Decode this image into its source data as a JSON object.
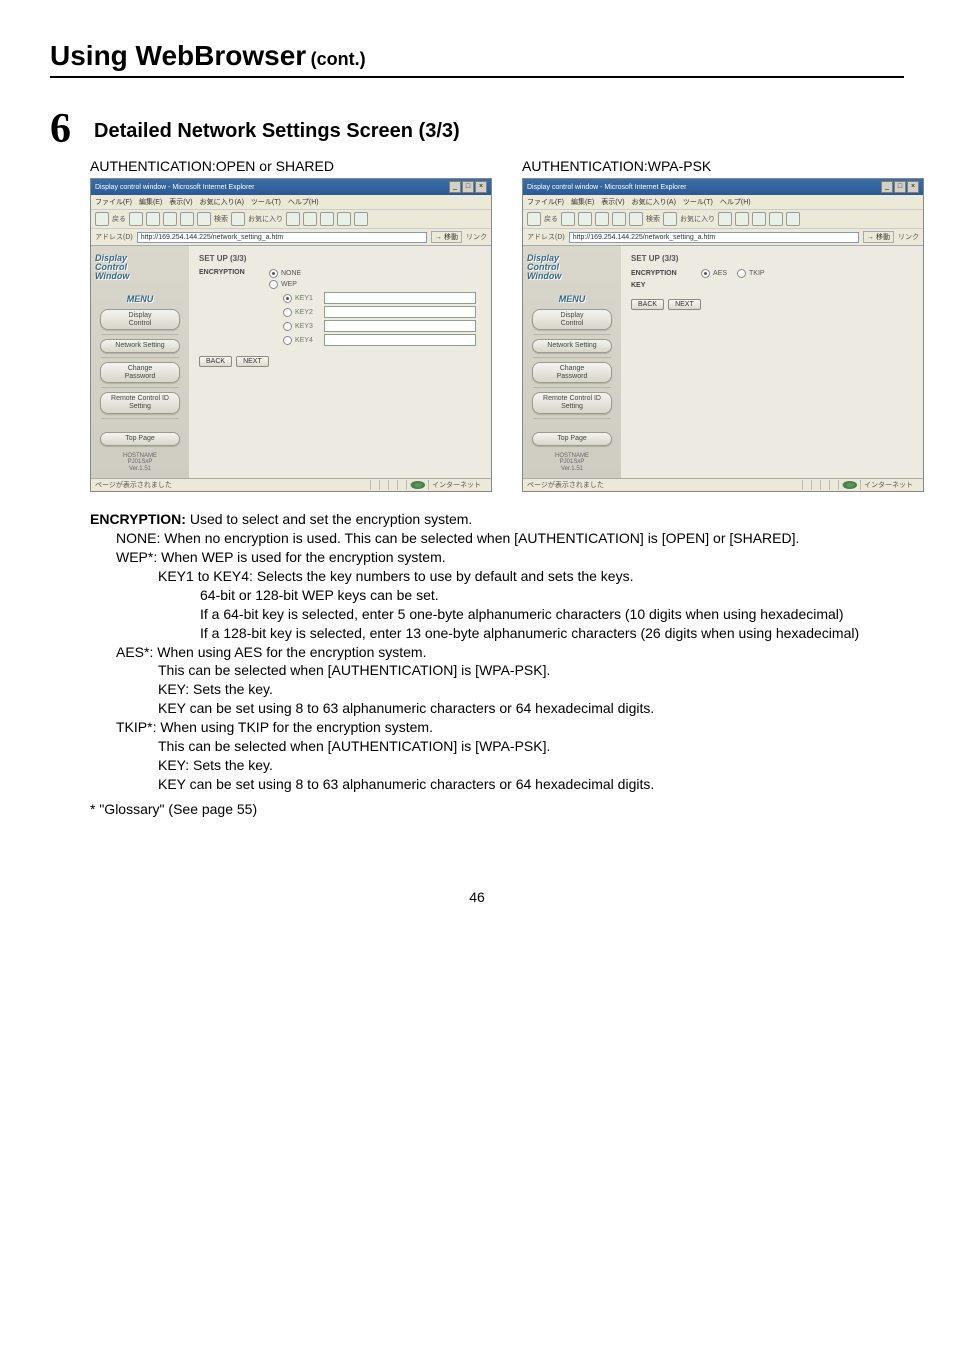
{
  "header": {
    "main": "Using WebBrowser",
    "sub": "(cont.)"
  },
  "step": {
    "number": "6",
    "title": "Detailed Network Settings Screen (3/3)"
  },
  "auth_labels": {
    "open_shared": "AUTHENTICATION:OPEN or SHARED",
    "wpa_psk": "AUTHENTICATION:WPA-PSK"
  },
  "browser": {
    "title": "Display control window - Microsoft Internet Explorer",
    "menubar": "ファイル(F)　編集(E)　表示(V)　お気に入り(A)　ツール(T)　ヘルプ(H)",
    "toolbar": {
      "back": "戻る",
      "search": "検索",
      "fav": "お気に入り"
    },
    "address_label": "アドレス(D)",
    "address_value": "http://169.254.144.225/network_setting_a.htm",
    "go": "移動",
    "links": "リンク",
    "sidebar": {
      "brand_l1": "Display",
      "brand_l2": "Control",
      "brand_l3": "Window",
      "menu": "MENU",
      "items": {
        "display_control": "Display\nControl",
        "network_setting": "Network Setting",
        "change_password": "Change\nPassword",
        "remote_id": "Remote Control ID\nSetting",
        "top_page": "Top Page"
      },
      "host_l1": "HOSTNAME",
      "host_l2": "PJ01SxP",
      "host_l3": "Ver.1.51"
    },
    "content_open": {
      "setup": "SET UP (3/3)",
      "encryption": "ENCRYPTION",
      "opt_none": "NONE",
      "opt_wep": "WEP",
      "key1": "KEY1",
      "key2": "KEY2",
      "key3": "KEY3",
      "key4": "KEY4",
      "back": "BACK",
      "next": "NEXT"
    },
    "content_wpa": {
      "setup": "SET UP (3/3)",
      "encryption": "ENCRYPTION",
      "opt_aes": "AES",
      "opt_tkip": "TKIP",
      "key_label": "KEY",
      "back": "BACK",
      "next": "NEXT"
    },
    "status_left": "ページが表示されました",
    "status_right": "インターネット"
  },
  "body": {
    "lead_bold": "ENCRYPTION:",
    "lead_rest": " Used to select and set the encryption system.",
    "none": "NONE: When no encryption is used. This can be selected when [AUTHENTICATION] is [OPEN] or [SHARED].",
    "wep_head": "WEP*:  When WEP is used for the encryption system.",
    "wep_l1": "KEY1 to KEY4: Selects the key numbers to use by default and sets the keys.",
    "wep_l2": "64-bit or 128-bit WEP keys can be set.",
    "wep_l3": "If a 64-bit key is selected, enter 5 one-byte alphanumeric characters (10 digits when using hexadecimal)",
    "wep_l4": "If a 128-bit key is selected, enter 13 one-byte alphanumeric characters (26 digits when using hexadecimal)",
    "aes_head": "AES*:   When using AES for the encryption system.",
    "aes_l1": "This can be selected when [AUTHENTICATION] is [WPA-PSK].",
    "aes_l2": "KEY:    Sets the key.",
    "aes_l3": " KEY can be set using 8 to 63 alphanumeric characters or 64 hexadecimal digits.",
    "tkip_head": "TKIP*:  When using TKIP for the encryption system.",
    "tkip_l1": "This can be selected when [AUTHENTICATION] is [WPA-PSK].",
    "tkip_l2": "KEY:    Sets the key.",
    "tkip_l3": " KEY can be set using 8 to 63 alphanumeric characters or 64 hexadecimal digits.",
    "footnote": "* \"Glossary\" (See page 55)"
  },
  "page_number": "46"
}
